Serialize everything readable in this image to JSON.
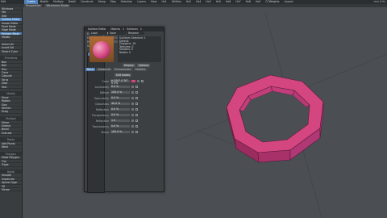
{
  "menu": {
    "label": "Edit",
    "tabs": [
      "Create",
      "Modify",
      "Multiply",
      "Detail",
      "Construct",
      "Setup",
      "Map",
      "Selection",
      "Layers",
      "View",
      "Hx1",
      "Utilities",
      "Hx2",
      "Hx4",
      "Hx3",
      "Hx5",
      "Hx6",
      "Hx7",
      "Hx8",
      "Hx9",
      "CCWeights",
      "Layout"
    ],
    "active_tab": 0,
    "title": "nice (Hh)"
  },
  "subbar": [
    "Perspective",
    "Wireframe Shade"
  ],
  "sidebar": {
    "items": [
      {
        "label": "Windows",
        "sel": false
      },
      {
        "label": "File",
        "sel": false
      },
      {
        "label": "Edit",
        "sel": false
      },
      {
        "label": "Surface Editor",
        "sel": true
      },
      {
        "label": "Image Editor",
        "sel": false
      },
      {
        "label": "Point Mode",
        "sel": false
      },
      {
        "label": "Edge Mode",
        "sel": false
      },
      {
        "label": "Polygon Mode",
        "sel": true
      },
      {
        "label": "Modes",
        "sel": false
      },
      {
        "label": "",
        "sel": false
      },
      {
        "label": "Select All",
        "sel": false
      },
      {
        "label": "Invert Sel",
        "sel": false
      },
      {
        "label": "Sketch Color",
        "sel": false
      },
      {
        "label": "",
        "sel": false
      },
      {
        "label": "Primitives",
        "hd": true
      },
      {
        "label": "Box",
        "sel": false
      },
      {
        "label": "Ball",
        "sel": false
      },
      {
        "label": "Disc",
        "sel": false
      },
      {
        "label": "Cone",
        "sel": false
      },
      {
        "label": "Capsule",
        "sel": false
      },
      {
        "label": "Torus",
        "sel": false
      },
      {
        "label": "Gear",
        "sel": false
      },
      {
        "label": "Text",
        "sel": false
      },
      {
        "label": "",
        "sel": false
      },
      {
        "label": "Modify",
        "hd": true
      },
      {
        "label": "Move",
        "sel": false
      },
      {
        "label": "Rotate",
        "sel": false
      },
      {
        "label": "Size",
        "sel": false
      },
      {
        "label": "Stretch",
        "sel": false
      },
      {
        "label": "Drag",
        "sel": false
      },
      {
        "label": "",
        "sel": false
      },
      {
        "label": "Multiply",
        "hd": true
      },
      {
        "label": "Mirror",
        "sel": false
      },
      {
        "label": "Extend",
        "sel": false
      },
      {
        "label": "Bevel",
        "sel": false
      },
      {
        "label": "Extrude",
        "sel": false
      },
      {
        "label": "",
        "sel": false
      },
      {
        "label": "Points",
        "hd": true
      },
      {
        "label": "Add Points",
        "sel": false
      },
      {
        "label": "Weld",
        "sel": false
      },
      {
        "label": "",
        "sel": false
      },
      {
        "label": "Polygon",
        "hd": true
      },
      {
        "label": "Make Polygon",
        "sel": false
      },
      {
        "label": "Flip",
        "sel": false
      },
      {
        "label": "Triple",
        "sel": false
      },
      {
        "label": "",
        "sel": false
      },
      {
        "label": "Detail",
        "hd": true
      },
      {
        "label": "Smooth",
        "sel": false
      },
      {
        "label": "Subdivide",
        "sel": false
      },
      {
        "label": "Spline Cage",
        "sel": false
      },
      {
        "label": "Fill",
        "sel": false
      },
      {
        "label": "Merge",
        "sel": false
      }
    ]
  },
  "dialog": {
    "title": "Surface Editor",
    "edit_by_label": "Edit by",
    "edit_by_value": "Object",
    "filter_label": "Filter by",
    "filter_value": "Name",
    "pattern_label": "Pattern",
    "list_header": "Surface Name",
    "surfaces": [
      {
        "label": "Default",
        "sel": true
      }
    ],
    "objects_label": "Objects",
    "objects_value": "1",
    "surfaces_label": "Surfaces",
    "surfaces_value": "1",
    "col_headers": [
      "Load",
      "Save",
      "Rename"
    ],
    "info_lines": [
      "Surfaces Selected: 1",
      "Default",
      "Polygons: 16",
      "Textures: 0",
      "Shaders: 0",
      "Nodes: 0"
    ],
    "tabs": [
      "Basic",
      "Advanced",
      "Environment",
      "Shaders"
    ],
    "active_tab": 0,
    "edit_nodes": "Edit Nodes",
    "display_label": "Display",
    "options_label": "Options",
    "props": [
      {
        "k": "Color",
        "v": "H 320° S 70° V 0%"
      },
      {
        "k": "Luminosity",
        "v": "0.0 %"
      },
      {
        "k": "Diffuse",
        "v": "100.0 %"
      },
      {
        "k": "Specularity",
        "v": "0.0 %"
      },
      {
        "k": "Glossiness",
        "v": "40.0 %"
      },
      {
        "k": "Reflection",
        "v": "0.0 %"
      },
      {
        "k": "Transparency",
        "v": "0.0 %"
      },
      {
        "k": "Refraction",
        "v": "1.0"
      },
      {
        "k": "Translucency",
        "v": "0.0 %"
      },
      {
        "k": "Bump",
        "v": "100.0 %"
      }
    ]
  },
  "colors": {
    "accent": "#4d7fb8",
    "ring": "#d4467f",
    "ring_dark": "#8e2656"
  }
}
